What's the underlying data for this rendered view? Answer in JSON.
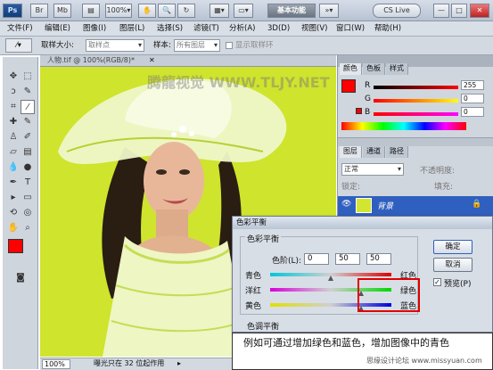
{
  "app": {
    "ps_badge": "Ps",
    "workspace_button": "基本功能",
    "cs_live": "CS Live",
    "window_min": "—",
    "window_max": "□",
    "window_close": "✕"
  },
  "menu": [
    "文件(F)",
    "编辑(E)",
    "图像(I)",
    "图层(L)",
    "选择(S)",
    "滤镜(T)",
    "分析(A)",
    "3D(D)",
    "视图(V)",
    "窗口(W)",
    "帮助(H)"
  ],
  "options_bar": {
    "sample_size_label": "取样大小:",
    "sample_size_value": "取样点",
    "sample_label": "样本:",
    "sample_value": "所有图层",
    "show_ring_label": "显示取样环"
  },
  "document": {
    "tab_title": "人物.tif @ 100%(RGB/8)*",
    "watermark": "腾龍视觉 WWW.TLJY.NET",
    "zoom": "100%",
    "status": "曝光只在 32 位起作用"
  },
  "color_panel": {
    "tabs": [
      "颜色",
      "色板",
      "样式"
    ],
    "r_label": "R",
    "g_label": "G",
    "b_label": "B",
    "r_value": "255",
    "g_value": "0",
    "b_value": "0",
    "foreground": "#ff0000"
  },
  "layers_panel": {
    "tabs": [
      "图层",
      "通道",
      "路径"
    ],
    "blend_mode": "正常",
    "opacity_label": "不透明度:",
    "lock_label": "锁定:",
    "fill_label": "填充:",
    "layer_name": "背景"
  },
  "dialog": {
    "title": "色彩平衡",
    "group_label": "色彩平衡",
    "levels_label": "色阶(L):",
    "level1": "0",
    "level2": "50",
    "level3": "50",
    "ok_label": "确定",
    "cancel_label": "取消",
    "preview_label": "预览(P)",
    "tone_label": "色调平衡",
    "rows": [
      {
        "left": "青色",
        "right": "红色",
        "value": 0
      },
      {
        "left": "洋红",
        "right": "绿色",
        "value": 50
      },
      {
        "left": "黄色",
        "right": "蓝色",
        "value": 50
      }
    ]
  },
  "caption": {
    "text": "例如可通过增加绿色和蓝色，增加图像中的青色",
    "site": "思缘设计论坛 www.missyuan.com"
  }
}
